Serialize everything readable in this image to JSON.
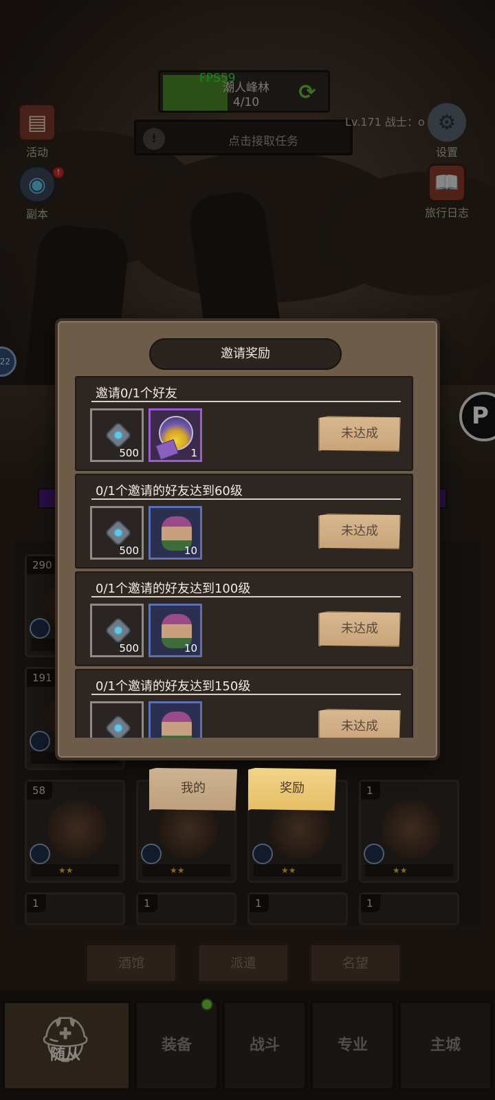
{
  "hud": {
    "fps": "FPS59",
    "zone_name": "潮人峰林",
    "zone_progress": "4/10",
    "quest_prompt": "点击接取任务",
    "player_info": "Lv.171 战士：o"
  },
  "side_buttons": {
    "activity": "活动",
    "dungeon": "副本",
    "settings": "设置",
    "journal": "旅行日志"
  },
  "left_round_value": "22",
  "right_round_glyph": "P",
  "hero_cards": [
    {
      "num": "290"
    },
    {
      "num": "191"
    },
    {
      "num": "58"
    },
    {
      "num": "1"
    },
    {
      "num": "1"
    },
    {
      "num": "1"
    },
    {
      "num": "1"
    },
    {
      "num": "1"
    }
  ],
  "sub_tabs": [
    "酒馆",
    "派遣",
    "名望"
  ],
  "bottom_nav": {
    "active": "随从",
    "tabs": [
      "装备",
      "战斗",
      "专业",
      "主城"
    ]
  },
  "modal": {
    "title": "邀请奖励",
    "rows": [
      {
        "title": "邀请0/1个好友",
        "items": [
          {
            "qty": "500"
          },
          {
            "qty": "1"
          }
        ],
        "button": "未达成"
      },
      {
        "title": "0/1个邀请的好友达到60级",
        "items": [
          {
            "qty": "500"
          },
          {
            "qty": "10"
          }
        ],
        "button": "未达成"
      },
      {
        "title": "0/1个邀请的好友达到100级",
        "items": [
          {
            "qty": "500"
          },
          {
            "qty": "10"
          }
        ],
        "button": "未达成"
      },
      {
        "title": "0/1个邀请的好友达到150级",
        "items": [
          {
            "qty": ""
          },
          {
            "qty": ""
          }
        ],
        "button": "未达成"
      }
    ]
  },
  "modal_tabs": {
    "mine": "我的",
    "reward": "奖励"
  }
}
